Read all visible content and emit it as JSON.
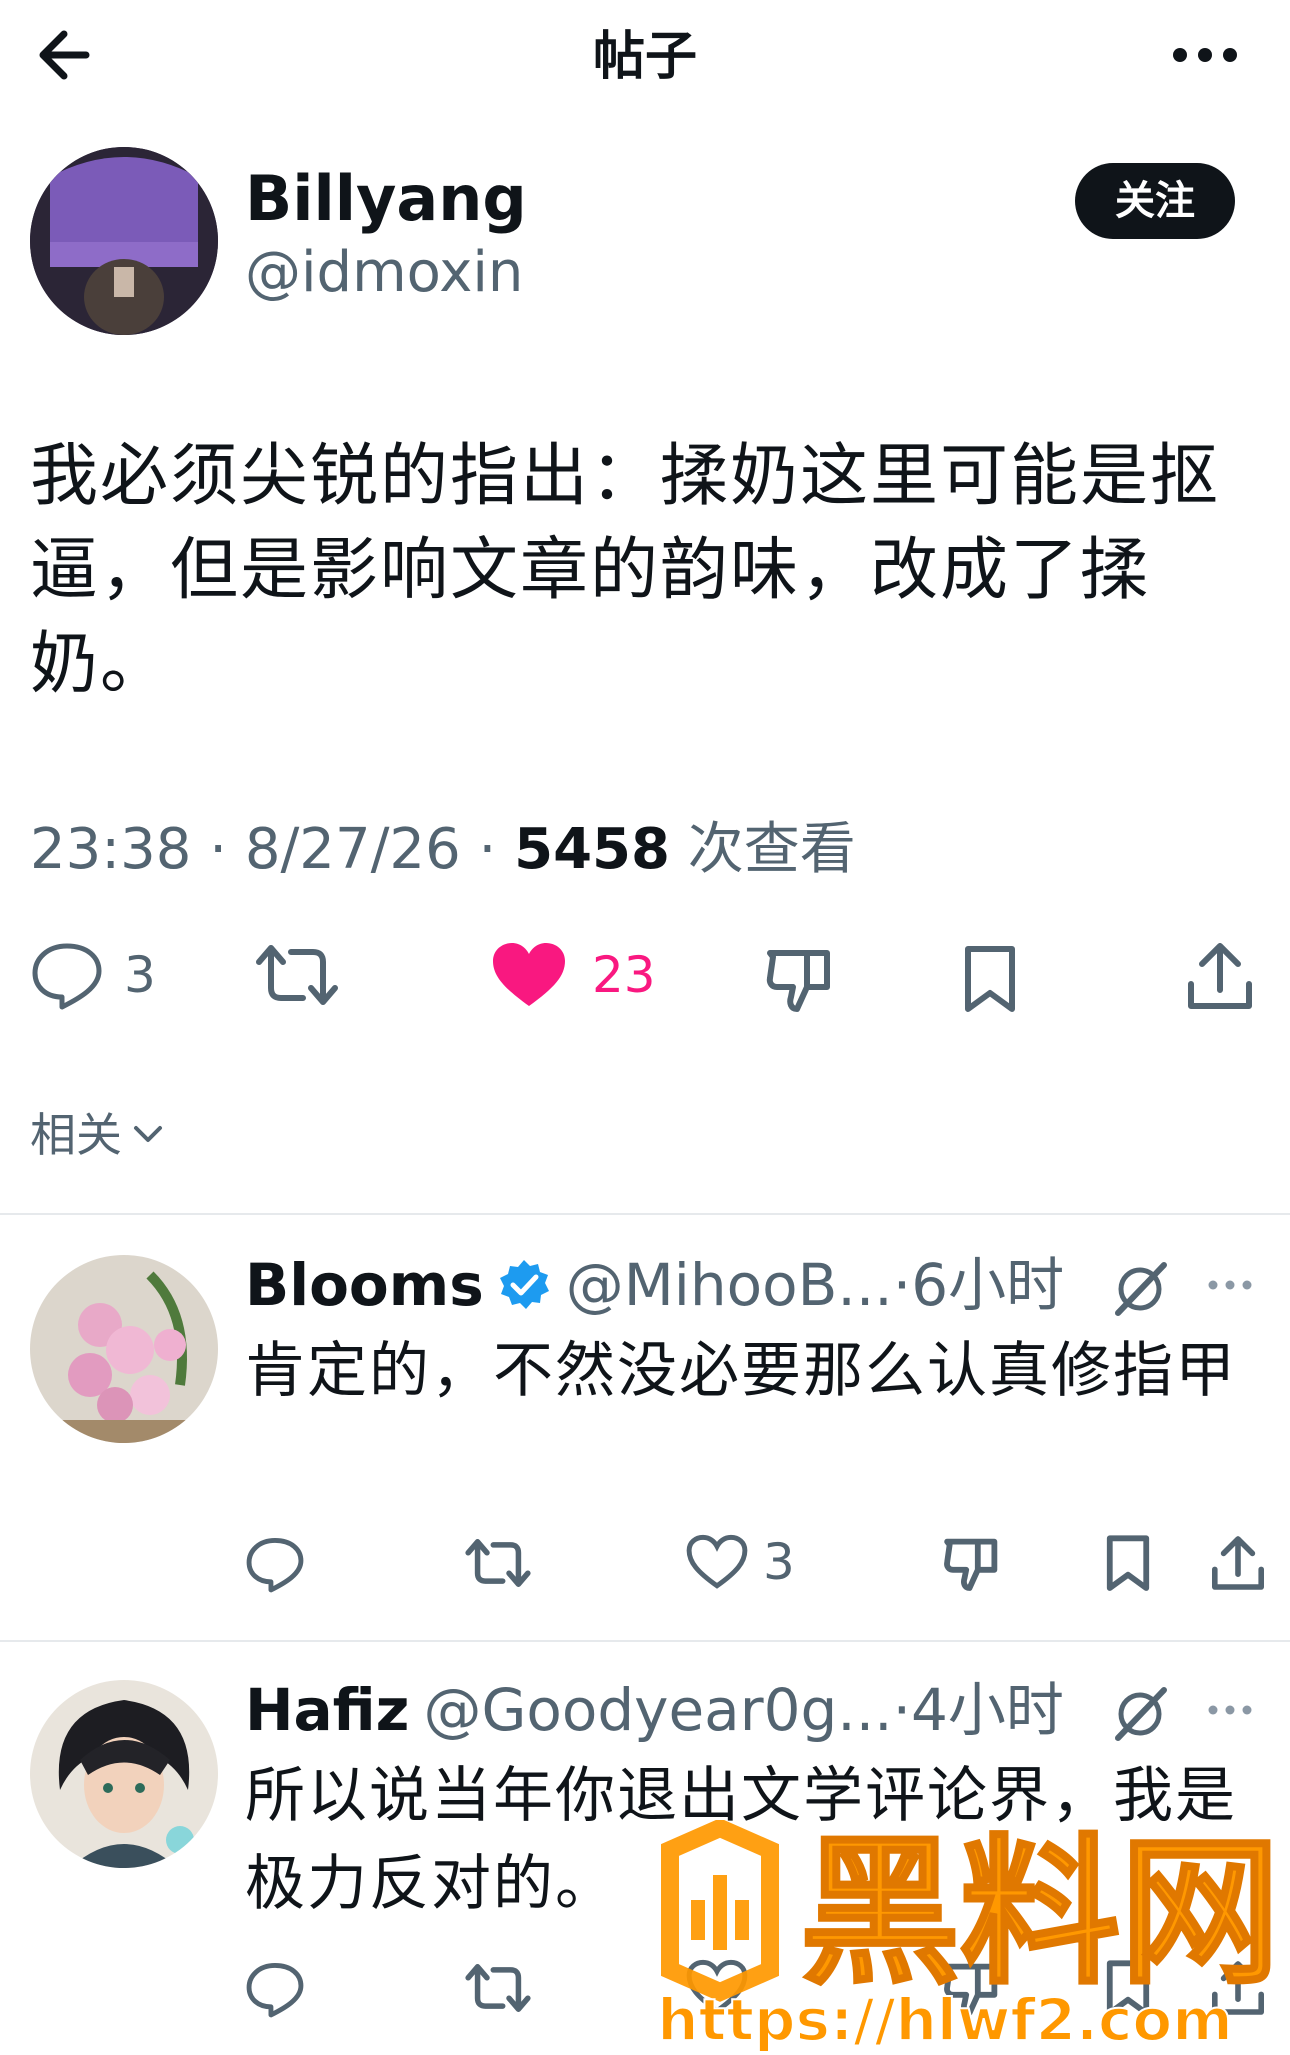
{
  "header": {
    "title": "帖子"
  },
  "post": {
    "author_name": "Billyang",
    "author_handle": "@idmoxin",
    "follow_label": "关注",
    "text": "我必须尖锐的指出：揉奶这里可能是抠逼，但是影响文章的韵味，改成了揉奶。",
    "time": "23:38",
    "date": "8/27/26",
    "views": "5458",
    "views_suffix": "次查看",
    "reply_count": "3",
    "like_count": "23",
    "like_color": "#f91880"
  },
  "related": {
    "label": "相关"
  },
  "replies": [
    {
      "name": "Blooms",
      "verified": true,
      "handle": "@MihooB...",
      "time": "6小时",
      "text": "肯定的，不然没必要那么认真修指甲",
      "like_count": "3"
    },
    {
      "name": "Hafiz",
      "verified": false,
      "handle": "@Goodyear0g...",
      "time": "4小时",
      "text": "所以说当年你退出文学评论界，我是极力反对的。",
      "like_count": ""
    }
  ],
  "watermark": {
    "text": "黑料网",
    "url": "https://hlwf2.com",
    "color": "#ff9800"
  }
}
